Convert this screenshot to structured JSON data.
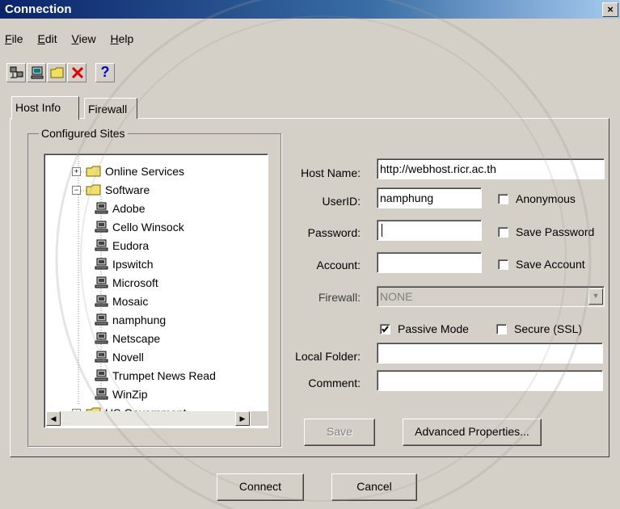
{
  "window": {
    "title": "Connection",
    "close_glyph": "×"
  },
  "menu": [
    "File",
    "Edit",
    "View",
    "Help"
  ],
  "toolbar": {
    "icons": [
      "connect-icon",
      "host-icon",
      "folder-icon",
      "delete-icon",
      "help-icon"
    ],
    "help_glyph": "?"
  },
  "tabs": [
    "Host Info",
    "Firewall"
  ],
  "sites": {
    "legend": "Configured Sites",
    "tree": [
      {
        "label": "Online Services",
        "type": "folder",
        "expander": "+"
      },
      {
        "label": "Software",
        "type": "folder",
        "expander": "−"
      },
      {
        "label": "Adobe",
        "type": "host"
      },
      {
        "label": "Cello Winsock",
        "type": "host"
      },
      {
        "label": "Eudora",
        "type": "host"
      },
      {
        "label": "Ipswitch",
        "type": "host"
      },
      {
        "label": "Microsoft",
        "type": "host"
      },
      {
        "label": "Mosaic",
        "type": "host"
      },
      {
        "label": "namphung",
        "type": "host"
      },
      {
        "label": "Netscape",
        "type": "host"
      },
      {
        "label": "Novell",
        "type": "host"
      },
      {
        "label": "Trumpet News Read",
        "type": "host"
      },
      {
        "label": "WinZip",
        "type": "host"
      },
      {
        "label": "US Government",
        "type": "folder",
        "expander": "+"
      }
    ]
  },
  "form": {
    "host_name_label": "Host Name:",
    "host_name_value": "http://webhost.ricr.ac.th",
    "userid_label": "UserID:",
    "userid_value": "namphung",
    "password_label": "Password:",
    "password_value": "",
    "account_label": "Account:",
    "account_value": "",
    "firewall_label": "Firewall:",
    "firewall_value": "NONE",
    "local_folder_label": "Local Folder:",
    "local_folder_value": "",
    "comment_label": "Comment:",
    "comment_value": "",
    "anonymous_label": "Anonymous",
    "save_password_label": "Save Password",
    "save_account_label": "Save Account",
    "passive_mode_label": "Passive Mode",
    "secure_ssl_label": "Secure (SSL)",
    "anonymous_checked": false,
    "save_password_checked": false,
    "save_account_checked": false,
    "passive_mode_checked": true,
    "secure_ssl_checked": false
  },
  "buttons": {
    "save": "Save",
    "advanced": "Advanced Properties...",
    "connect": "Connect",
    "cancel": "Cancel"
  },
  "colors": {
    "title_start": "#0a246a",
    "title_end": "#a6caf0",
    "face": "#d4d0c8"
  }
}
